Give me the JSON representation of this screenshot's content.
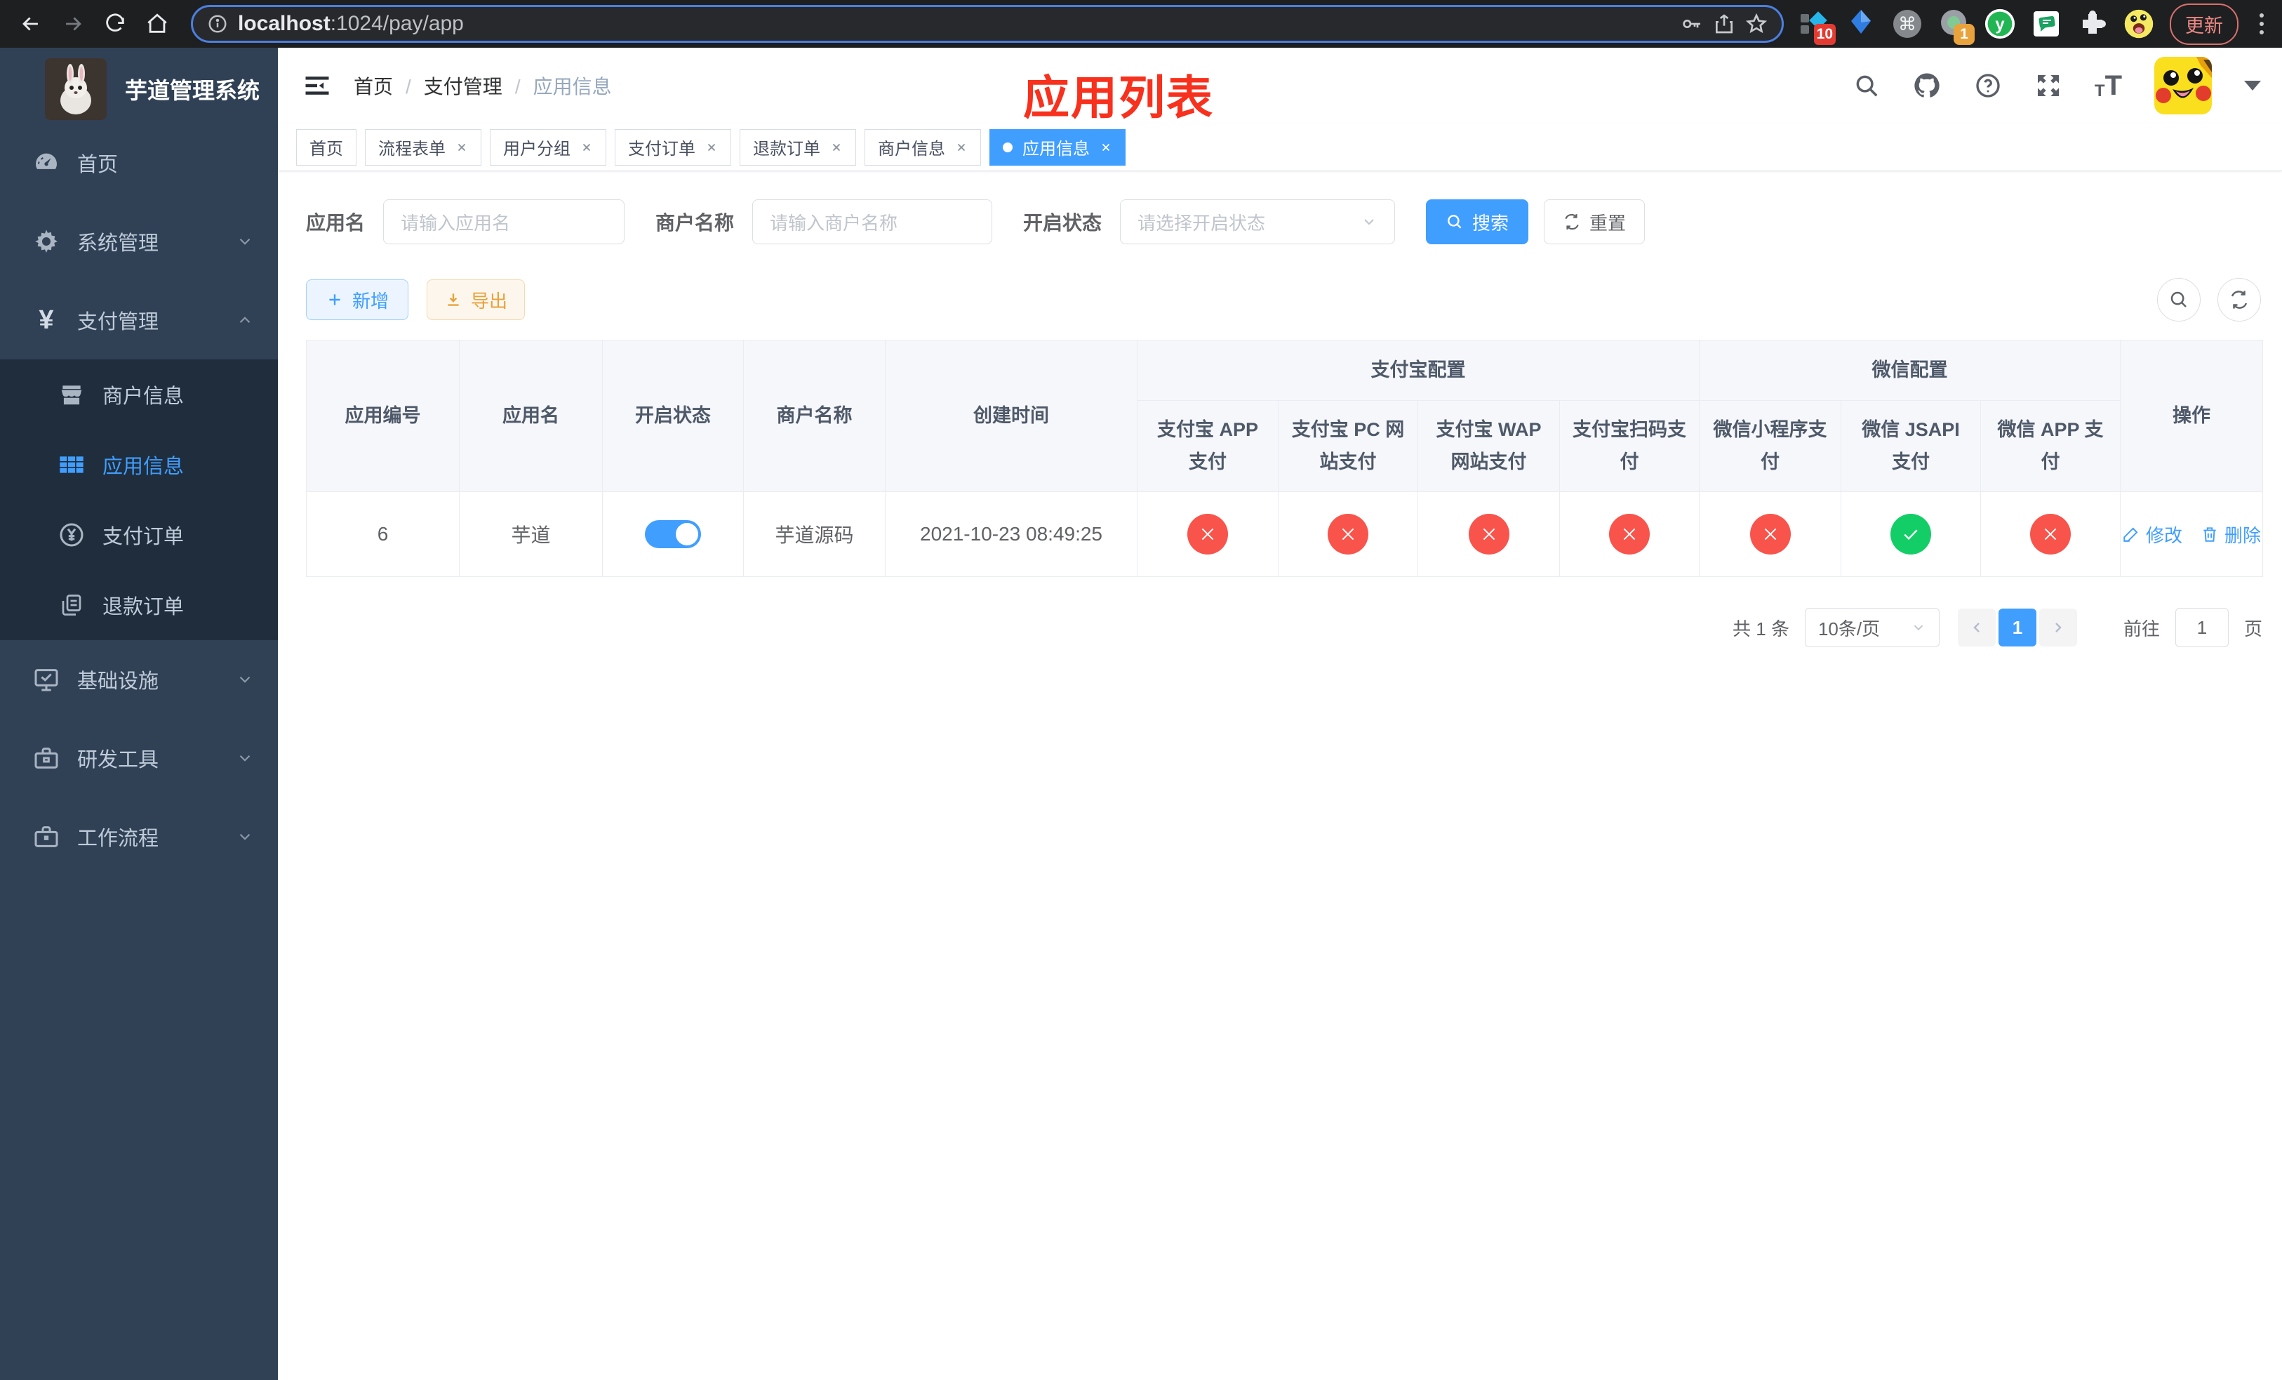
{
  "colors": {
    "accent": "#409eff",
    "warning": "#e6a23c",
    "status_off": "#f8544b",
    "status_on": "#13ce66",
    "annotation": "#f7311d",
    "sidebar_bg": "#304156",
    "submenu_bg": "#1f2d3d",
    "sidebar_text": "#bfcbd9"
  },
  "browser": {
    "url_host": "localhost",
    "url_rest": ":1024/pay/app",
    "extension_badge_a": "10",
    "extension_badge_b": "1",
    "update_label": "更新"
  },
  "sidebar": {
    "title": "芋道管理系统",
    "items": [
      {
        "label": "首页"
      },
      {
        "label": "系统管理"
      },
      {
        "label": "支付管理"
      }
    ],
    "submenu": [
      {
        "label": "商户信息"
      },
      {
        "label": "应用信息"
      },
      {
        "label": "支付订单"
      },
      {
        "label": "退款订单"
      }
    ],
    "items_bottom": [
      {
        "label": "基础设施"
      },
      {
        "label": "研发工具"
      },
      {
        "label": "工作流程"
      }
    ]
  },
  "header": {
    "breadcrumb": [
      "首页",
      "支付管理",
      "应用信息"
    ],
    "annotation": "应用列表"
  },
  "tabs": [
    {
      "label": "首页"
    },
    {
      "label": "流程表单"
    },
    {
      "label": "用户分组"
    },
    {
      "label": "支付订单"
    },
    {
      "label": "退款订单"
    },
    {
      "label": "商户信息"
    },
    {
      "label": "应用信息"
    }
  ],
  "filters": {
    "app_name_label": "应用名",
    "app_name_placeholder": "请输入应用名",
    "merchant_label": "商户名称",
    "merchant_placeholder": "请输入商户名称",
    "status_label": "开启状态",
    "status_placeholder": "请选择开启状态",
    "search_label": "搜索",
    "reset_label": "重置"
  },
  "toolbar": {
    "add_label": "新增",
    "export_label": "导出"
  },
  "table": {
    "group_headers": {
      "alipay": "支付宝配置",
      "wechat": "微信配置"
    },
    "columns": [
      "应用编号",
      "应用名",
      "开启状态",
      "商户名称",
      "创建时间",
      "支付宝 APP 支付",
      "支付宝 PC 网站支付",
      "支付宝 WAP 网站支付",
      "支付宝扫码支付",
      "微信小程序支付",
      "微信 JSAPI 支付",
      "微信 APP 支付",
      "操作"
    ],
    "rows": [
      {
        "id": "6",
        "name": "芋道",
        "enabled": true,
        "merchant": "芋道源码",
        "created_at": "2021-10-23 08:49:25",
        "alipay_app": "off",
        "alipay_pc": "off",
        "alipay_wap": "off",
        "alipay_qr": "off",
        "wx_mini": "off",
        "wx_jsapi": "on",
        "wx_app": "off",
        "edit_label": "修改",
        "delete_label": "删除"
      }
    ]
  },
  "pagination": {
    "total_text": "共 1 条",
    "page_size": "10条/页",
    "current_page": "1",
    "goto_label": "前往",
    "goto_value": "1",
    "page_unit": "页"
  }
}
